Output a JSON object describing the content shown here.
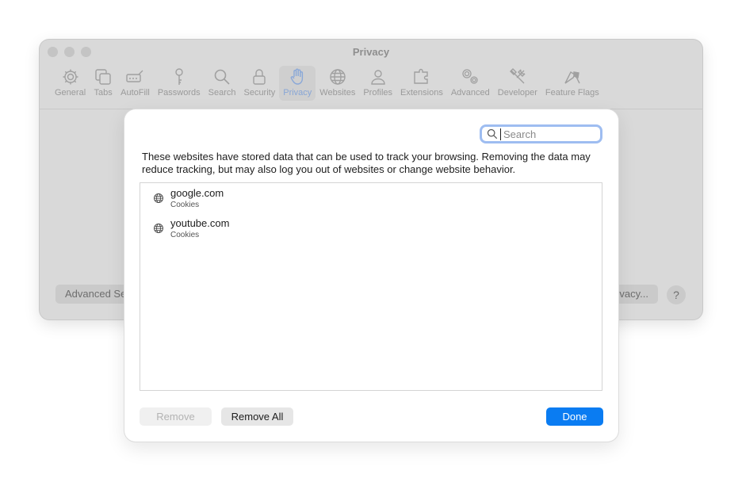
{
  "window": {
    "title": "Privacy",
    "tabs": [
      {
        "label": "General",
        "icon": "gear-icon"
      },
      {
        "label": "Tabs",
        "icon": "tabs-icon"
      },
      {
        "label": "AutoFill",
        "icon": "autofill-icon"
      },
      {
        "label": "Passwords",
        "icon": "key-icon"
      },
      {
        "label": "Search",
        "icon": "magnifier-icon"
      },
      {
        "label": "Security",
        "icon": "lock-icon"
      },
      {
        "label": "Privacy",
        "icon": "hand-icon",
        "active": true
      },
      {
        "label": "Websites",
        "icon": "globe-icon"
      },
      {
        "label": "Profiles",
        "icon": "person-icon"
      },
      {
        "label": "Extensions",
        "icon": "puzzle-icon"
      },
      {
        "label": "Advanced",
        "icon": "gears-icon"
      },
      {
        "label": "Developer",
        "icon": "tools-icon"
      },
      {
        "label": "Feature Flags",
        "icon": "flags-icon"
      }
    ],
    "left_button": "Advanced Se",
    "right_button": "vacy...",
    "help": "?"
  },
  "sheet": {
    "search": {
      "placeholder": "Search",
      "value": ""
    },
    "description": "These websites have stored data that can be used to track your browsing. Removing the data may reduce tracking, but may also log you out of websites or change website behavior.",
    "websites": [
      {
        "name": "google.com",
        "type": "Cookies"
      },
      {
        "name": "youtube.com",
        "type": "Cookies"
      }
    ],
    "buttons": {
      "remove": "Remove",
      "remove_all": "Remove All",
      "done": "Done"
    }
  },
  "colors": {
    "accent": "#0a7cf2",
    "focus_ring": "#9ebdf1",
    "dim_background": "#d9d9d9"
  }
}
